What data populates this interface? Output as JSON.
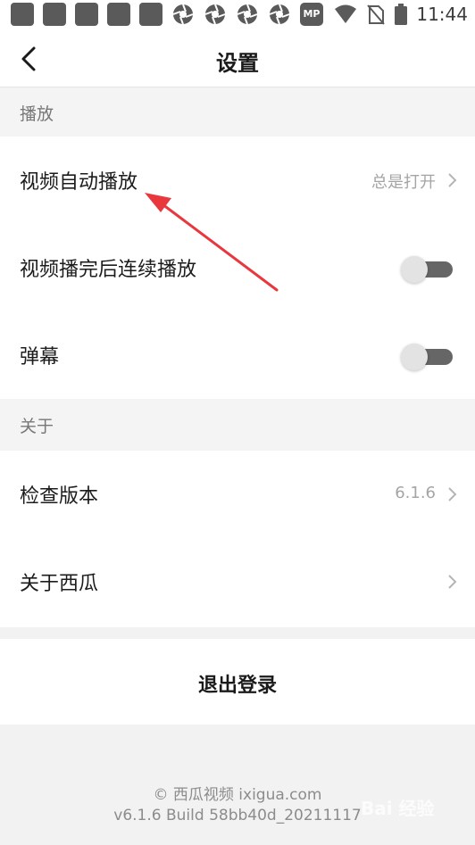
{
  "status_bar": {
    "time": "11:44",
    "mp_label": "MP",
    "icons": [
      "notification-square-icon",
      "notification-square-icon",
      "notification-square-icon",
      "notification-square-icon",
      "notification-square-icon",
      "aperture-icon",
      "aperture-icon",
      "aperture-icon",
      "aperture-icon",
      "mp-app-icon",
      "wifi-icon",
      "no-sim-icon",
      "battery-icon"
    ]
  },
  "header": {
    "title": "设置"
  },
  "sections": {
    "playback": {
      "title": "播放",
      "autoplay_label": "视频自动播放",
      "autoplay_value": "总是打开",
      "continuous_label": "视频播完后连续播放",
      "continuous_on": false,
      "danmaku_label": "弹幕",
      "danmaku_on": false
    },
    "about": {
      "title": "关于",
      "version_label": "检查版本",
      "version_value": "6.1.6",
      "about_label": "关于西瓜"
    }
  },
  "logout": {
    "label": "退出登录"
  },
  "footer": {
    "copyright": "© 西瓜视频 ixigua.com",
    "build": "v6.1.6 Build 58bb40d_20211117"
  },
  "watermark": {
    "text": "Bai 经验"
  },
  "colors": {
    "accent_arrow": "#e8383d",
    "toggle_track": "#666666",
    "toggle_knob": "#e3e3e3",
    "secondary_text": "#a5a5a5"
  }
}
